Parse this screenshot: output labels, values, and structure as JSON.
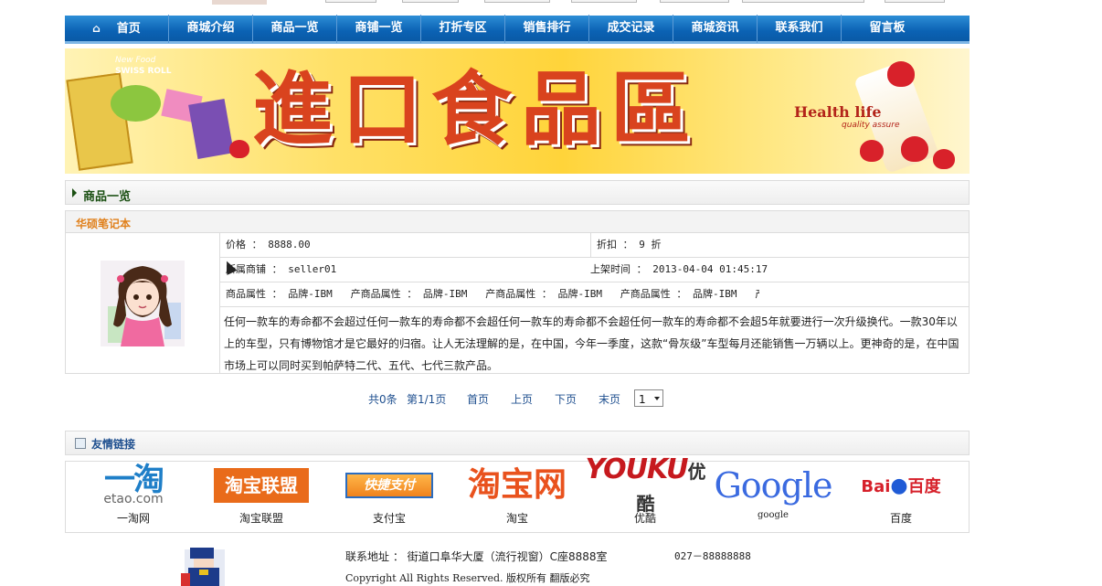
{
  "nav": {
    "items": [
      "首页",
      "商城介绍",
      "商品一览",
      "商铺一览",
      "打折专区",
      "销售排行",
      "成交记录",
      "商城资讯",
      "联系我们",
      "留言板"
    ]
  },
  "banner": {
    "title": "進口食品區",
    "tagline": "Health life",
    "subtagline": "quality assure",
    "brand1": "New Food",
    "brand2": "SWISS ROLL"
  },
  "section": {
    "title": "商品一览"
  },
  "product": {
    "name": "华硕笔记本",
    "price_label": "价格 ： 8888.00",
    "discount_label": "折扣 ： 9 折",
    "shop_label": "所属商铺 ： seller01",
    "time_label": "上架时间 ： 2013-04-04 01:45:17",
    "attrs_label": "商品属性 ： 品牌-IBM   产商品属性 ： 品牌-IBM   产商品属性 ： 品牌-IBM   产商品属性 ： 品牌-IBM   产",
    "description": " 任何一款车的寿命都不会超过任何一款车的寿命都不会超任何一款车的寿命都不会超任何一款车的寿命都不会超5年就要进行一次升级换代。一款30年以上的车型，只有博物馆才是它最好的归宿。让人无法理解的是，在中国，今年一季度，这款“骨灰级”车型每月还能销售一万辆以上。更神奇的是，在中国市场上可以同时买到帕萨特二代、五代、七代三款产品。"
  },
  "pager": {
    "total": "共0条",
    "page": "第1/1页",
    "first": "首页",
    "prev": "上页",
    "next": "下页",
    "last": "末页",
    "select_value": "1"
  },
  "friend_links": {
    "title": "友情链接",
    "items": [
      {
        "logo": "一淘",
        "logo_sub": "etao.com",
        "label": "一淘网"
      },
      {
        "logo": "淘宝联盟",
        "label": "淘宝联盟"
      },
      {
        "logo": "快捷支付",
        "label": "支付宝"
      },
      {
        "logo": "淘宝网",
        "label": "淘宝"
      },
      {
        "logo": "YOUKU",
        "logo_sub": "优酷",
        "label": "优酷"
      },
      {
        "logo": "Google",
        "label": "google"
      },
      {
        "logo": "Bai",
        "logo_sub": "百度",
        "label": "百度"
      }
    ]
  },
  "footer": {
    "address": "联系地址 ： 街道口阜华大厦（流行视窗）C座8888室",
    "tel": "027－88888888",
    "copyright": "Copyright All Rights Reserved. 版权所有   翻版必究"
  },
  "colors": {
    "nav_blue": "#0b62b4",
    "section_green": "#1a4f12",
    "product_orange": "#e0801b",
    "link_blue": "#1e4f8f"
  }
}
